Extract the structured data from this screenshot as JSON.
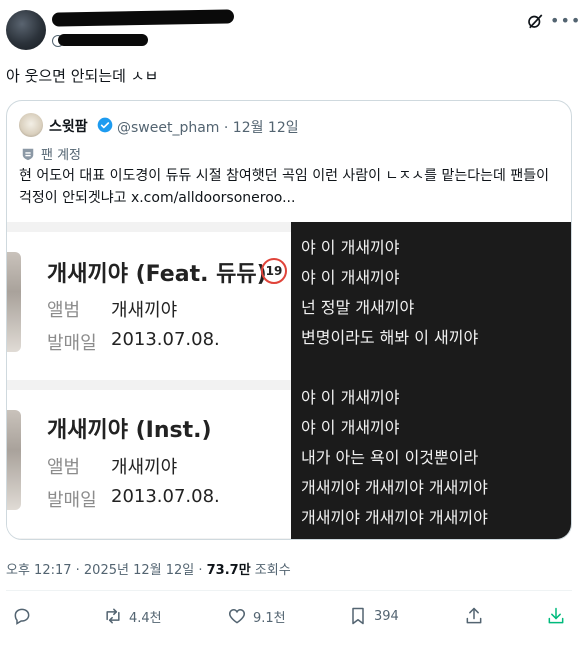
{
  "tweet": {
    "text": "아 웃으면 안되는데 ㅅㅂ"
  },
  "quote": {
    "name": "스윗팜",
    "handle": "@sweet_pham",
    "date": "· 12월 12일",
    "account_label": "팬 계정",
    "text": "현 어도어 대표 이도경이 듀듀 시절 참여햇던 곡임 이런 사람이 ㄴㅈㅅ를 맡는다는데 팬들이 걱정이 안되겟냐고 x.com/alldoorsoneroo...",
    "cards": [
      {
        "title": "개새끼야 (Feat. 듀듀)",
        "badge": "19",
        "album_label": "앨범",
        "album_value": "개새끼야",
        "release_label": "발매일",
        "release_value": "2013.07.08."
      },
      {
        "title": "개새끼야 (Inst.)",
        "album_label": "앨범",
        "album_value": "개새끼야",
        "release_label": "발매일",
        "release_value": "2013.07.08."
      }
    ],
    "lyrics": [
      "야 이 개새끼야",
      "야 이 개새끼야",
      "넌 정말 개새끼야",
      "변명이라도 해봐 이 새끼야",
      "야 이 개새끼야",
      "야 이 개새끼야",
      "내가 아는 욕이 이것뿐이라",
      "개새끼야 개새끼야 개새끼야",
      "개새끼야 개새끼야 개새끼야"
    ]
  },
  "meta": {
    "time": "오후 12:17 · 2025년 12월 12일 · ",
    "views": "73.7만",
    "views_label": " 조회수"
  },
  "actions": {
    "replies": "",
    "retweets": "4.4천",
    "likes": "9.1천",
    "bookmarks": "394"
  },
  "colors": {
    "accent": "#1d9bf0",
    "muted": "#536471",
    "border": "#cfd9de",
    "badge_red": "#e0443a"
  },
  "icons": [
    "grok-icon",
    "more-icon",
    "verified-icon",
    "fan-account-icon",
    "reply-icon",
    "retweet-icon",
    "like-icon",
    "bookmark-icon",
    "share-icon",
    "download-icon"
  ]
}
